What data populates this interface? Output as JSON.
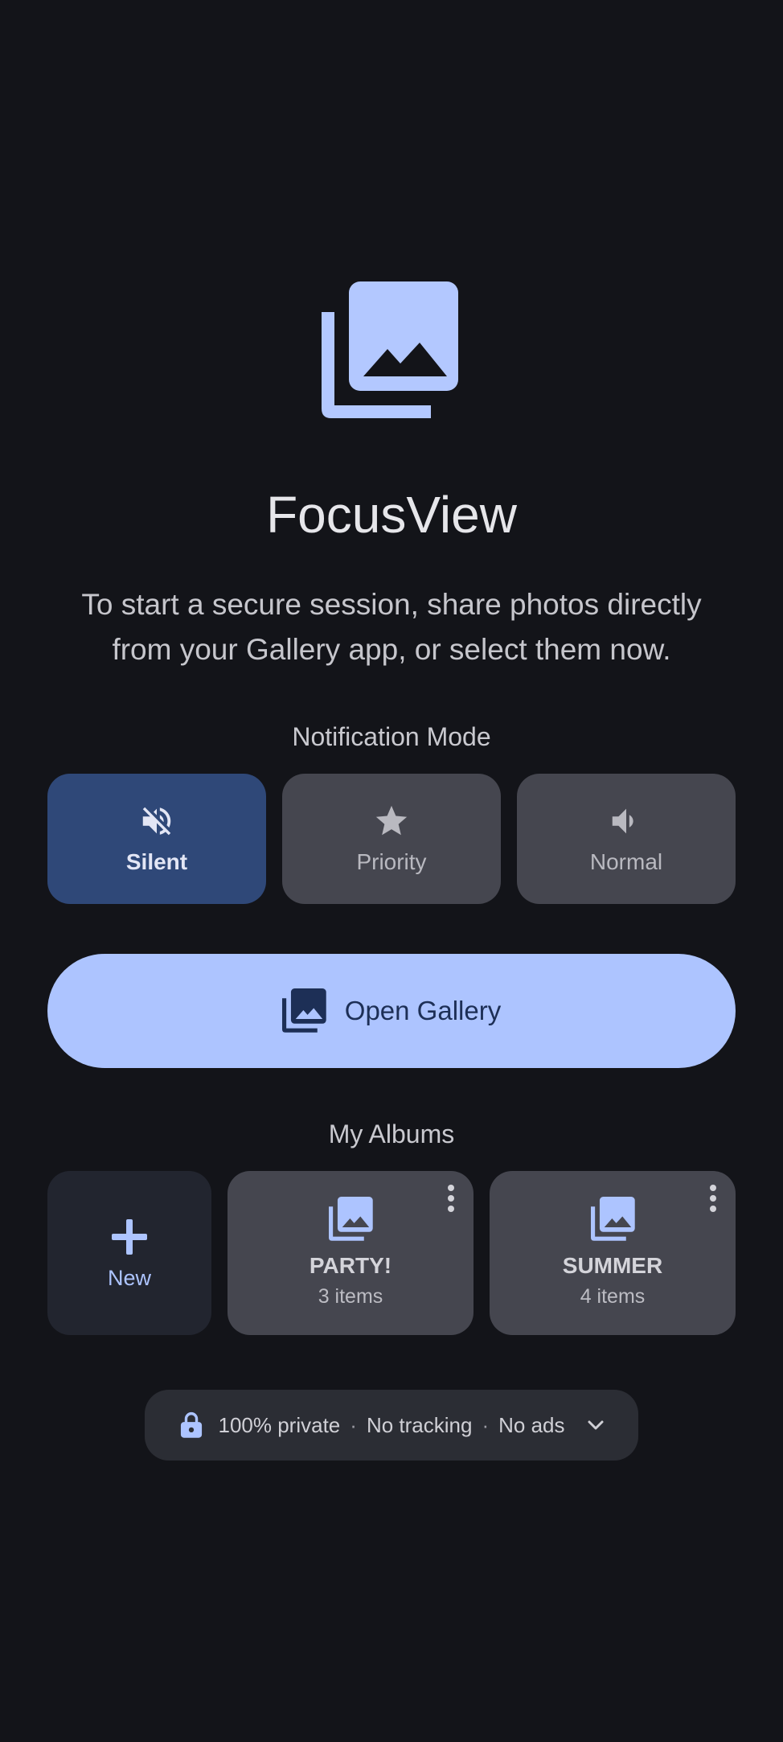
{
  "app": {
    "title": "FocusView",
    "subtitle": "To start a secure session, share photos directly from your Gallery app, or select them now.",
    "logo_icon": "photo-library-icon"
  },
  "notification_mode": {
    "label": "Notification Mode",
    "selected": "Silent",
    "options": [
      {
        "label": "Silent",
        "icon": "volume-off-icon"
      },
      {
        "label": "Priority",
        "icon": "star-icon"
      },
      {
        "label": "Normal",
        "icon": "volume-up-icon"
      }
    ]
  },
  "open_gallery": {
    "label": "Open Gallery",
    "icon": "photo-library-icon"
  },
  "albums": {
    "label": "My Albums",
    "new_label": "New",
    "items": [
      {
        "name": "PARTY!",
        "count": "3 items"
      },
      {
        "name": "SUMMER",
        "count": "4 items"
      }
    ]
  },
  "privacy": {
    "items": [
      "100% private",
      "No tracking",
      "No ads"
    ],
    "separator": "·"
  },
  "colors": {
    "background": "#131419",
    "accent": "#adc4ff",
    "selected_mode": "#2f4878",
    "card": "#45464f"
  }
}
